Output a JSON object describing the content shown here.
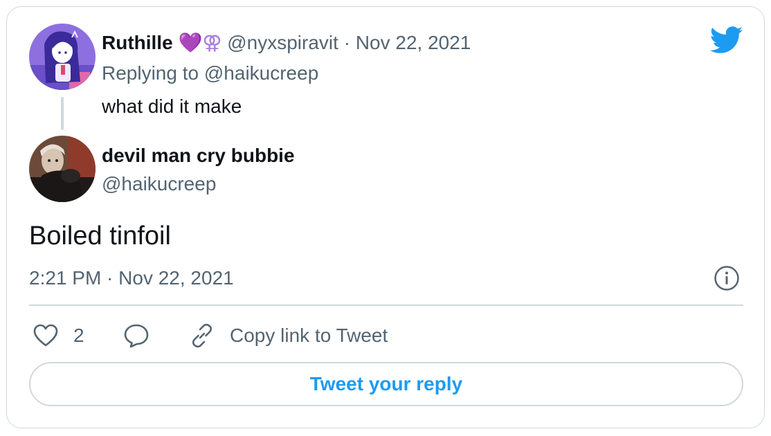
{
  "reply_tweet": {
    "author_name": "Ruthille",
    "name_emoji": "💜⚢",
    "handle": "@nyxspiravit",
    "separator": "·",
    "date": "Nov 22, 2021",
    "replying_to_label": "Replying to",
    "replying_to_handle": "@haikucreep",
    "text": "what did it make"
  },
  "main_tweet": {
    "author_name": "devil man cry bubbie",
    "handle": "@haikucreep",
    "text": "Boiled tinfoil",
    "timestamp": "2:21 PM · Nov 22, 2021"
  },
  "actions": {
    "like_count": "2",
    "copy_link_label": "Copy link to Tweet"
  },
  "reply_button_label": "Tweet your reply",
  "colors": {
    "twitter_blue": "#1d9bf0",
    "muted_text": "#536471",
    "border": "#cfd9de"
  },
  "icons": [
    "twitter-bird-icon",
    "info-icon",
    "heart-icon",
    "reply-bubble-icon",
    "link-icon"
  ]
}
